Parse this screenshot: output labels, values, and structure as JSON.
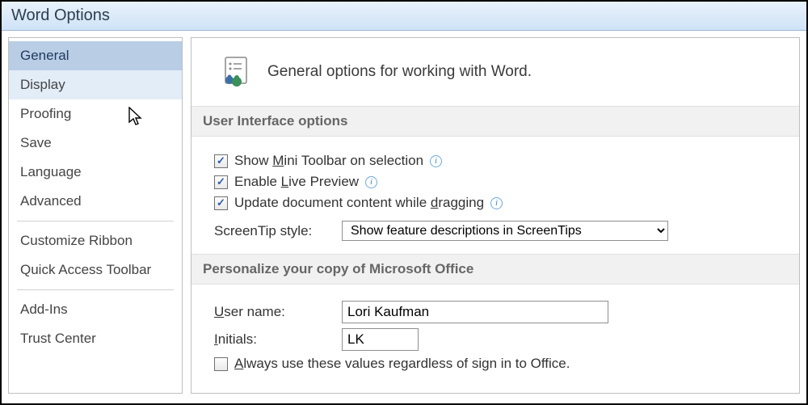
{
  "title": "Word Options",
  "sidebar": {
    "items": [
      {
        "label": "General"
      },
      {
        "label": "Display"
      },
      {
        "label": "Proofing"
      },
      {
        "label": "Save"
      },
      {
        "label": "Language"
      },
      {
        "label": "Advanced"
      },
      {
        "label": "Customize Ribbon"
      },
      {
        "label": "Quick Access Toolbar"
      },
      {
        "label": "Add-Ins"
      },
      {
        "label": "Trust Center"
      }
    ]
  },
  "hero": "General options for working with Word.",
  "ui_section": {
    "header": "User Interface options",
    "mini_pre": "Show ",
    "mini_u": "M",
    "mini_post": "ini Toolbar on selection",
    "live_pre": "Enable ",
    "live_u": "L",
    "live_post": "ive Preview",
    "drag_pre": "Update document content while ",
    "drag_u": "d",
    "drag_post": "ragging",
    "screentip_label": "ScreenTip style:",
    "screentip_value": "Show feature descriptions in ScreenTips"
  },
  "personalize": {
    "header": "Personalize your copy of Microsoft Office",
    "username_u": "U",
    "username_post": "ser name:",
    "username_value": "Lori Kaufman",
    "initials_u": "I",
    "initials_post": "nitials:",
    "initials_value": "LK",
    "always_u": "A",
    "always_post": "lways use these values regardless of sign in to Office."
  }
}
